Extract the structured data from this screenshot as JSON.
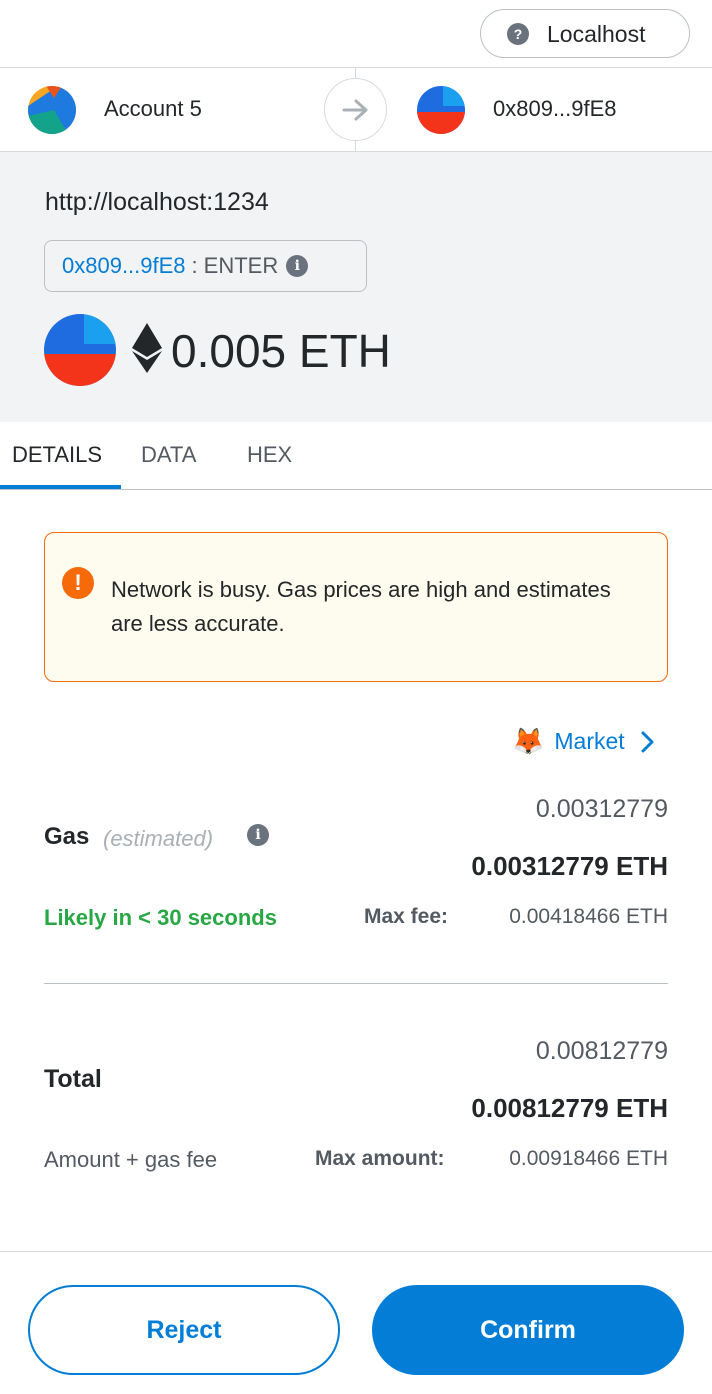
{
  "network": {
    "label": "Localhost",
    "help_glyph": "?"
  },
  "sender": {
    "name": "Account 5"
  },
  "recipient": {
    "address": "0x809...9fE8"
  },
  "summary": {
    "origin": "http://localhost:1234",
    "method_address": "0x809...9fE8",
    "method_separator": ":",
    "method_name": "ENTER",
    "amount": "0.005 ETH"
  },
  "tabs": [
    {
      "label": "DETAILS"
    },
    {
      "label": "DATA"
    },
    {
      "label": "HEX"
    }
  ],
  "warning": {
    "icon_glyph": "!",
    "text": "Network is busy. Gas prices are high and estimates are less accurate."
  },
  "market": {
    "label": "Market",
    "icon": "🦊"
  },
  "gas": {
    "label": "Gas",
    "estimated_label": "(estimated)",
    "fiat_value": "0.00312779",
    "eth_value": "0.00312779 ETH",
    "likely_text": "Likely in < 30 seconds",
    "max_fee_label": "Max fee:",
    "max_fee_value": "0.00418466 ETH"
  },
  "total": {
    "label": "Total",
    "fiat_value": "0.00812779",
    "eth_value": "0.00812779 ETH",
    "sub_label": "Amount + gas fee",
    "max_amount_label": "Max amount:",
    "max_amount_value": "0.00918466 ETH"
  },
  "buttons": {
    "reject": "Reject",
    "confirm": "Confirm"
  },
  "colors": {
    "accent": "#037dd6",
    "warning": "#f66a0a",
    "success": "#28a745",
    "summary_bg": "#f2f3f4"
  }
}
